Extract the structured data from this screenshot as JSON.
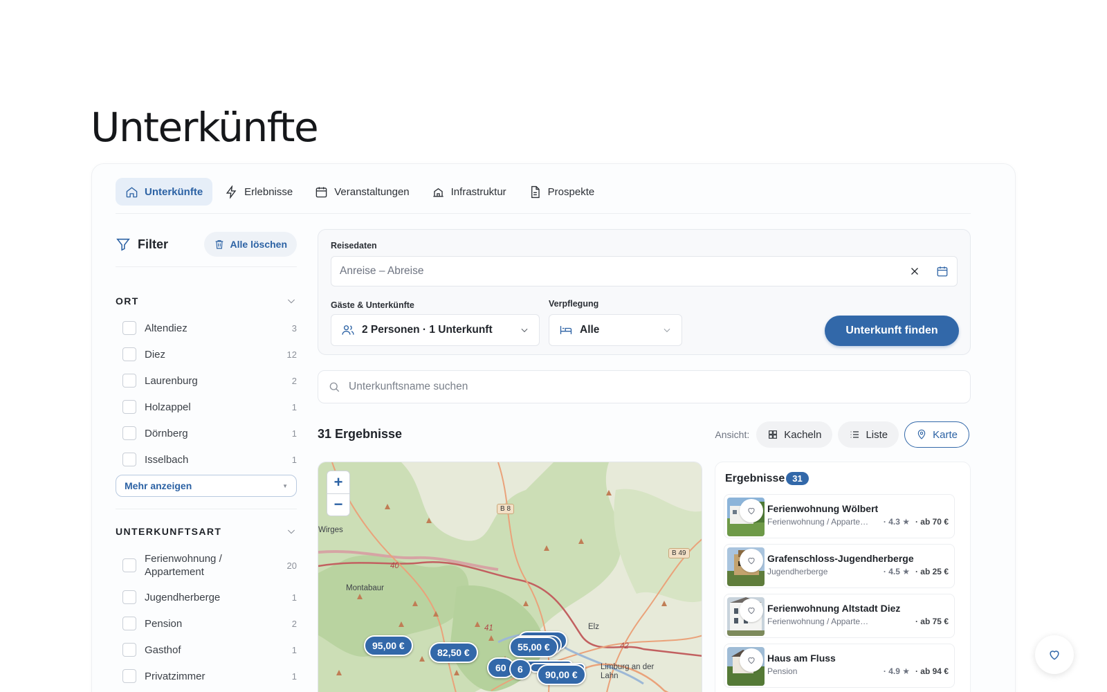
{
  "page_title": "Unterkünfte",
  "tabs": [
    {
      "label": "Unterkünfte",
      "icon": "home-icon",
      "active": true
    },
    {
      "label": "Erlebnisse",
      "icon": "bolt-icon",
      "active": false
    },
    {
      "label": "Veranstaltungen",
      "icon": "calendar-icon",
      "active": false
    },
    {
      "label": "Infrastruktur",
      "icon": "building-icon",
      "active": false
    },
    {
      "label": "Prospekte",
      "icon": "document-icon",
      "active": false
    }
  ],
  "filter": {
    "title": "Filter",
    "clear_label": "Alle löschen",
    "ort": {
      "heading": "ORT",
      "options": [
        {
          "label": "Altendiez",
          "count": "3"
        },
        {
          "label": "Diez",
          "count": "12"
        },
        {
          "label": "Laurenburg",
          "count": "2"
        },
        {
          "label": "Holzappel",
          "count": "1"
        },
        {
          "label": "Dörnberg",
          "count": "1"
        },
        {
          "label": "Isselbach",
          "count": "1"
        }
      ],
      "more_label": "Mehr anzeigen"
    },
    "unterkunftsart": {
      "heading": "UNTERKUNFTSART",
      "options": [
        {
          "label": "Ferienwohnung / Appartement",
          "count": "20"
        },
        {
          "label": "Jugendherberge",
          "count": "1"
        },
        {
          "label": "Pension",
          "count": "2"
        },
        {
          "label": "Gasthof",
          "count": "1"
        },
        {
          "label": "Privatzimmer",
          "count": "1"
        }
      ]
    }
  },
  "search": {
    "travel_dates_label": "Reisedaten",
    "travel_dates_placeholder": "Anreise – Abreise",
    "guests_label": "Gäste & Unterkünfte",
    "guests_value": "2 Personen · 1 Unterkunft",
    "board_label": "Verpflegung",
    "board_value": "Alle",
    "find_button": "Unterkunft finden",
    "name_placeholder": "Unterkunftsname suchen"
  },
  "results": {
    "count_label": "31 Ergebnisse",
    "view_label": "Ansicht:",
    "views": [
      {
        "label": "Kacheln",
        "active": false
      },
      {
        "label": "Liste",
        "active": false
      },
      {
        "label": "Karte",
        "active": true
      }
    ],
    "list_title": "Ergebnisse",
    "list_count": "31",
    "items": [
      {
        "name": "Ferienwohnung Wölbert",
        "type": "Ferienwohnung / Appartement",
        "rating": "· 4.3 ★",
        "price": "· ab 70 €"
      },
      {
        "name": "Grafenschloss-Jugendherberge",
        "type": "Jugendherberge",
        "rating": "· 4.5 ★",
        "price": "· ab 25 €"
      },
      {
        "name": "Ferienwohnung Altstadt Diez",
        "type": "Ferienwohnung / Appartement",
        "rating": "",
        "price": "· ab 75 €"
      },
      {
        "name": "Haus am Fluss",
        "type": "Pension",
        "rating": "· 4.9 ★",
        "price": "· ab 94 €"
      }
    ]
  },
  "map": {
    "zoom_in": "+",
    "zoom_out": "−",
    "places": [
      "Wirges",
      "Montabaur",
      "Elz",
      "Limburg an der Lahn"
    ],
    "roads": [
      "B 8",
      "B 49",
      "40",
      "41",
      "42"
    ],
    "pins": [
      "95,00 €",
      "82,50 €",
      "55,00 €",
      "60",
      "6",
      "90,00 €"
    ]
  },
  "colors": {
    "accent": "#3268a9",
    "active_tab_bg": "#e6eef8"
  }
}
